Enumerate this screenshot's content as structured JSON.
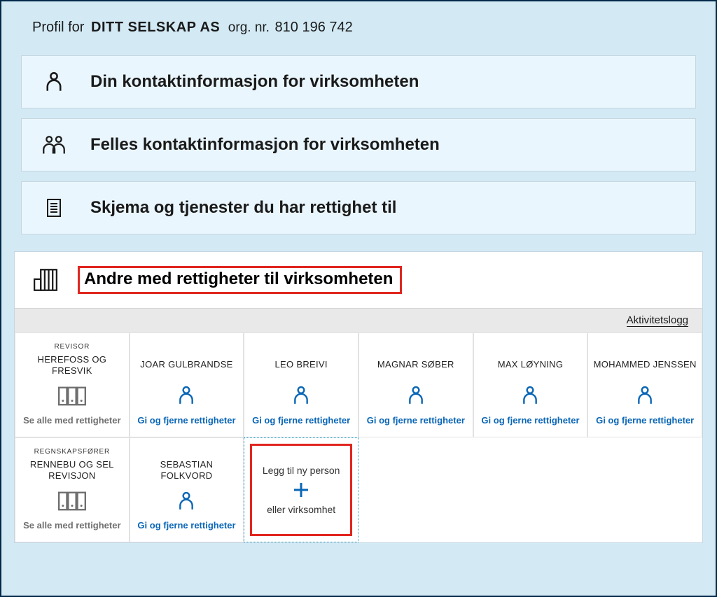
{
  "header": {
    "prefix": "Profil for",
    "company": "DITT SELSKAP AS",
    "org_label": "org. nr.",
    "org_number": "810 196 742"
  },
  "panels": [
    {
      "id": "own-contact",
      "label": "Din kontaktinformasjon for virksomheten"
    },
    {
      "id": "shared-contact",
      "label": "Felles kontaktinformasjon for virksomheten"
    },
    {
      "id": "forms-rights",
      "label": "Skjema og tjenester du har rettighet til"
    }
  ],
  "section": {
    "title": "Andre med rettigheter til virksomheten",
    "activity_log": "Aktivitetslogg"
  },
  "link_labels": {
    "see_all": "Se alle med rettigheter",
    "manage": "Gi og fjerne rettigheter"
  },
  "add_card": {
    "line1": "Legg til ny person",
    "line2": "eller virksomhet"
  },
  "cards": [
    {
      "role": "REVISOR",
      "name": "HEREFOSS OG FRESVIK",
      "icon": "books",
      "action": "see_all"
    },
    {
      "role": "",
      "name": "JOAR GULBRANDSE",
      "icon": "person",
      "action": "manage"
    },
    {
      "role": "",
      "name": "LEO BREIVI",
      "icon": "person",
      "action": "manage"
    },
    {
      "role": "",
      "name": "MAGNAR SØBER",
      "icon": "person",
      "action": "manage"
    },
    {
      "role": "",
      "name": "MAX LØYNING",
      "icon": "person",
      "action": "manage"
    },
    {
      "role": "",
      "name": "MOHAMMED JENSSEN",
      "icon": "person",
      "action": "manage"
    },
    {
      "role": "REGNSKAPSFØRER",
      "name": "RENNEBU OG SEL REVISJON",
      "icon": "books",
      "action": "see_all"
    },
    {
      "role": "",
      "name": "SEBASTIAN FOLKVORD",
      "icon": "person",
      "action": "manage"
    }
  ]
}
